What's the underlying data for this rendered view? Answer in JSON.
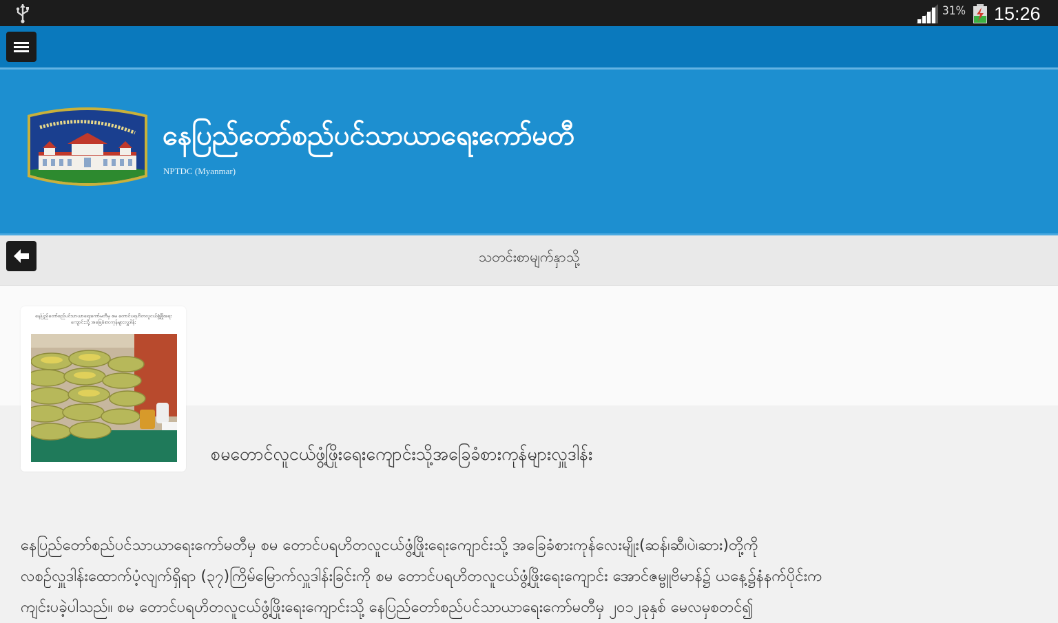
{
  "status_bar": {
    "battery": "31%",
    "time": "15:26",
    "icons": [
      "usb-icon",
      "signal-icon",
      "battery-icon"
    ]
  },
  "app_bar": {
    "menu_icon": "hamburger-menu-icon"
  },
  "banner": {
    "title": "နေပြည်တော်စည်ပင်သာယာရေးကော်မတီ",
    "subtitle": "NPTDC (Myanmar)",
    "logo_icon": "city-hall-logo"
  },
  "section": {
    "back_icon": "arrow-left-icon",
    "title": "သတင်းစာမျက်နှာသို့"
  },
  "article": {
    "thumbnail_caption": "နေပြည်တော်စည်ပင်သာယာရေးကော်မတီမှ စမ တောင်ပရဟိတလူငယ်ဖွံ့ဖြိုးရေးကျောင်းသို့ အခြေခံစားကုန်များလှူဒါန်း",
    "title": "စမတောင်လူငယ်ဖွံ့ဖြိုးရေးကျောင်းသို့အခြေခံစားကုန်များလှူဒါန်း",
    "body_lines": [
      "နေပြည်တော်စည်ပင်သာယာရေးကော်မတီမှ စမ တောင်ပရဟိတလူငယ်ဖွံ့ဖြိုးရေးကျောင်းသို့ အခြေခံစားကုန်လေးမျိုး(ဆန်၊ဆီ၊ပဲ၊ဆား)တို့ကို",
      "လစဉ်လှူဒါန်းထောက်ပံ့လျက်ရှိရာ (၃၇)ကြိမ်မြောက်လှူဒါန်းခြင်းကို စမ တောင်ပရဟိတလူငယ်ဖွံ့ဖြိုးရေးကျောင်း အောင်ဇမ္ဗူဗိမာန်၌ ယနေ့၌နံနက်ပိုင်းက",
      "ကျင်းပခဲ့ပါသည်။ စမ တောင်ပရဟိတလူငယ်ဖွံ့ဖြိုးရေးကျောင်းသို့ နေပြည်တော်စည်ပင်သာယာရေးကော်မတီမှ ၂၀၁၂ခုနှစ် မေလမှစတင်၍"
    ]
  },
  "colors": {
    "status_bar": "#1c1c1c",
    "app_bar": "#0a79bd",
    "banner": "#1d8fd0",
    "section_bar": "#e9e9e9",
    "background": "#f1f1f1"
  }
}
